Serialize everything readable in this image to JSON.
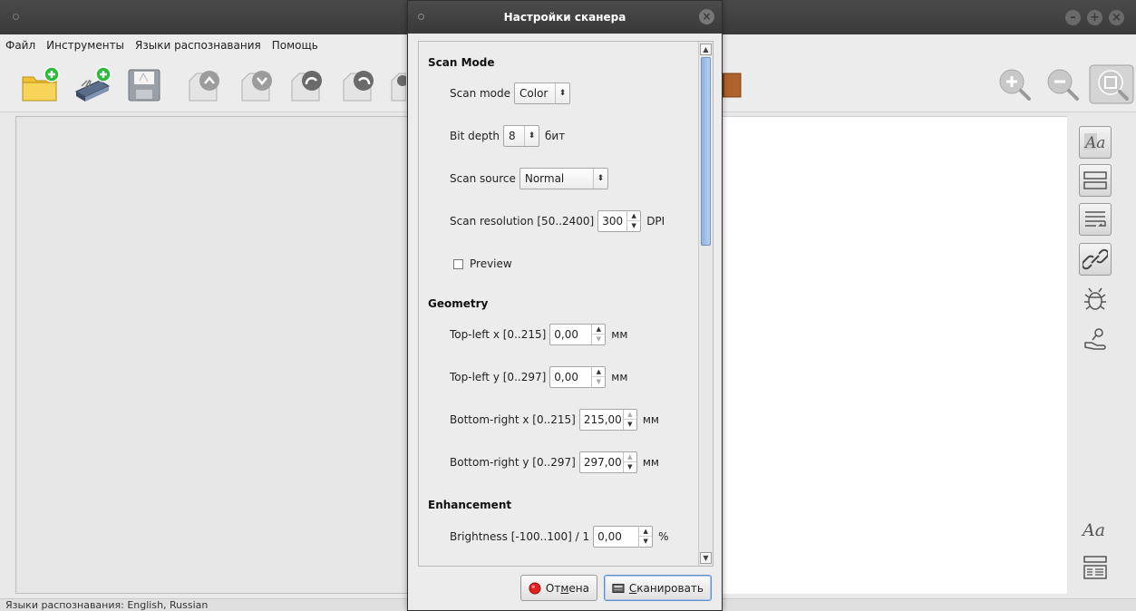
{
  "menu": [
    "Файл",
    "Инструменты",
    "Языки распознавания",
    "Помощь"
  ],
  "statusbar": "Языки распознавания: English, Russian",
  "dialog": {
    "title": "Настройки сканера",
    "sections": {
      "scan_mode": "Scan Mode",
      "geometry": "Geometry",
      "enhancement": "Enhancement"
    },
    "scan_mode": {
      "label": "Scan mode",
      "value": "Color"
    },
    "bit_depth": {
      "label": "Bit depth",
      "value": "8",
      "unit": "бит"
    },
    "scan_source": {
      "label": "Scan source",
      "value": "Normal"
    },
    "scan_resolution": {
      "label": "Scan resolution [50..2400]",
      "value": "300",
      "unit": "DPI"
    },
    "preview": {
      "label": "Preview",
      "checked": false
    },
    "top_left_x": {
      "label": "Top-left x [0..215]",
      "value": "0,00",
      "unit": "мм"
    },
    "top_left_y": {
      "label": "Top-left y [0..297]",
      "value": "0,00",
      "unit": "мм"
    },
    "bottom_right_x": {
      "label": "Bottom-right x [0..215]",
      "value": "215,00",
      "unit": "мм"
    },
    "bottom_right_y": {
      "label": "Bottom-right y [0..297]",
      "value": "297,00",
      "unit": "мм"
    },
    "brightness": {
      "label": "Brightness [-100..100] / 1",
      "value": "0,00",
      "unit": "%"
    },
    "cancel": {
      "pre": "От",
      "accel": "м",
      "post": "ена"
    },
    "scan": {
      "accel": "С",
      "post": "канировать"
    }
  },
  "colors": {
    "titlebar": "#3f3f3f",
    "accent": "#7fa7da",
    "cancel_red": "#e02020"
  }
}
